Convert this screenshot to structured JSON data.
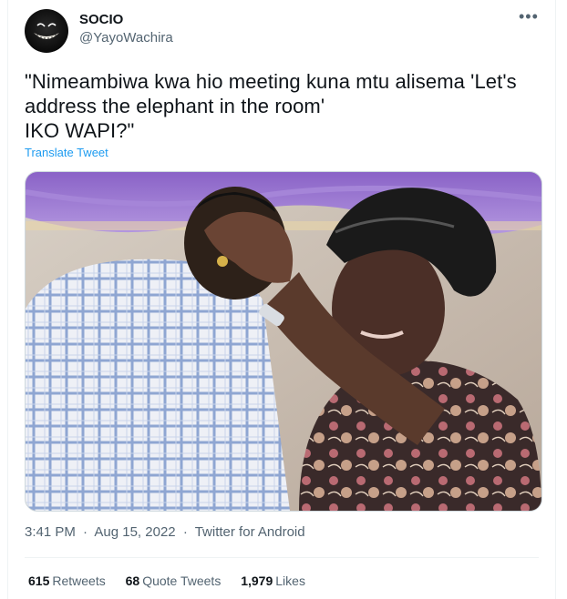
{
  "author": {
    "display_name": "SOCIO",
    "handle": "@YayoWachira"
  },
  "tweet": {
    "text": "\"Nimeambiwa kwa hio meeting kuna mtu alisema 'Let's address the elephant in the room'\nIKO WAPI?\"",
    "translate_label": "Translate Tweet"
  },
  "meta": {
    "time": "3:41 PM",
    "date": "Aug 15, 2022",
    "source": "Twitter for Android",
    "separator": "·"
  },
  "stats": {
    "retweets_count": "615",
    "retweets_label": "Retweets",
    "quotes_count": "68",
    "quotes_label": "Quote Tweets",
    "likes_count": "1,979",
    "likes_label": "Likes"
  },
  "icons": {
    "more": "more-options-icon"
  },
  "colors": {
    "link": "#1d9bf0",
    "muted": "#536471",
    "text": "#0f1419"
  }
}
